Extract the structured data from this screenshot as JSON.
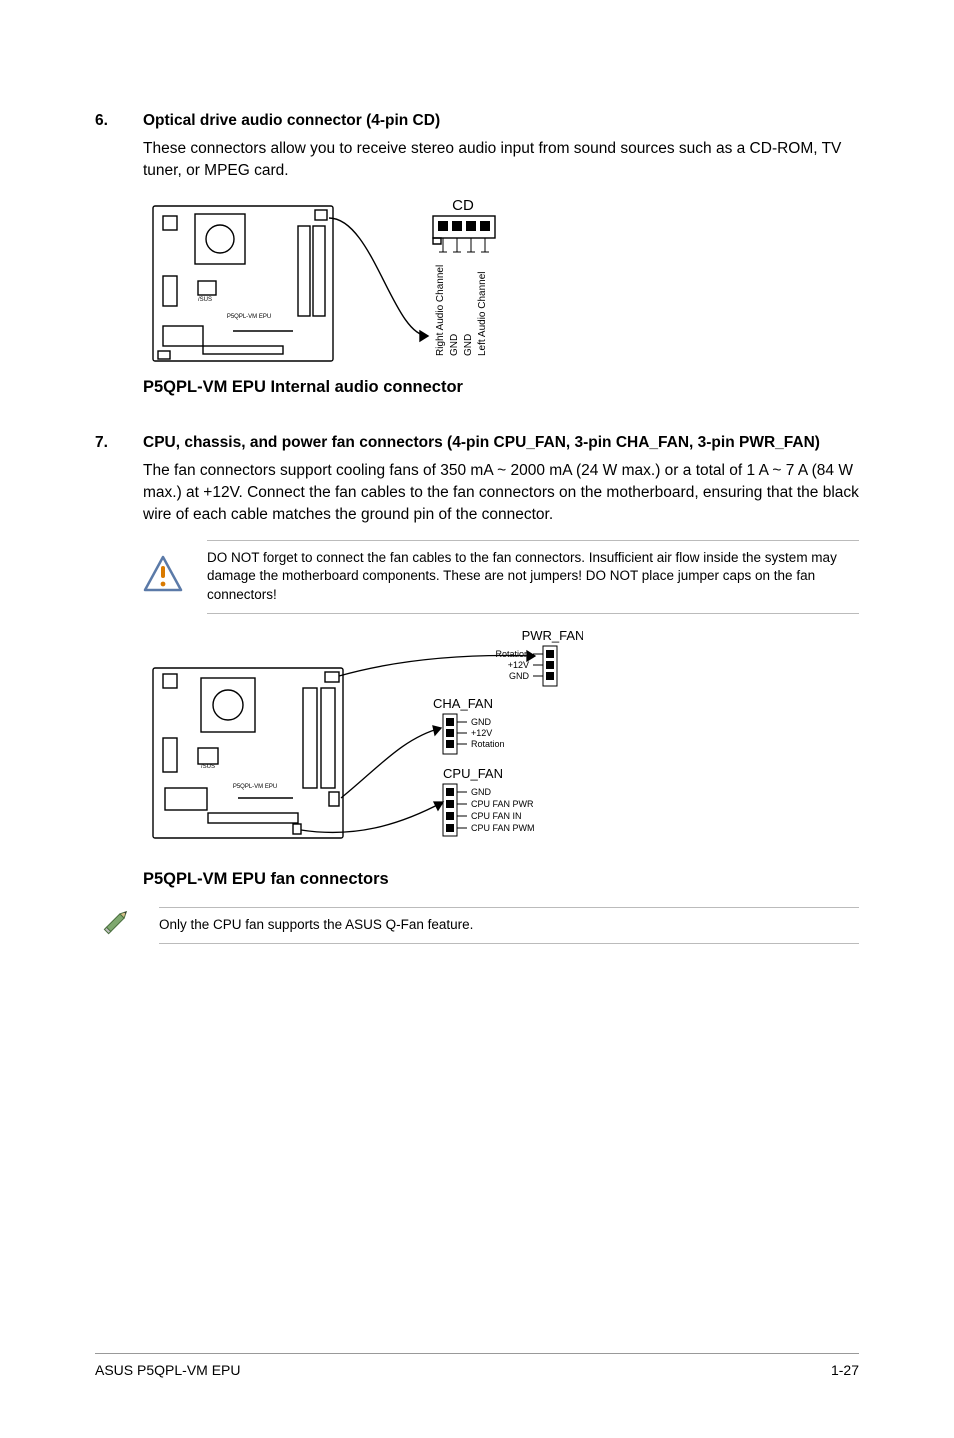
{
  "section6": {
    "num": "6.",
    "title": "Optical drive audio connector (4-pin CD)",
    "body": "These connectors allow you to receive stereo audio input from sound sources such as a CD-ROM, TV tuner, or MPEG card.",
    "fig": {
      "header_label": "CD",
      "pins": {
        "p1": "Right Audio Channel",
        "p2": "GND",
        "p3": "GND",
        "p4": "Left Audio Channel"
      },
      "caption": "P5QPL-VM EPU Internal audio connector"
    }
  },
  "section7": {
    "num": "7.",
    "title": "CPU, chassis, and power fan connectors (4-pin CPU_FAN, 3-pin CHA_FAN, 3-pin PWR_FAN)",
    "body": "The fan connectors support cooling fans of 350 mA ~ 2000 mA (24 W max.) or a total of 1 A ~ 7 A (84 W max.) at +12V. Connect the fan cables to the fan connectors on the motherboard, ensuring that the black wire of each cable matches the ground pin of the connector.",
    "warn": "DO NOT forget to connect the fan cables to the fan connectors. Insufficient air flow inside the system may damage the motherboard components. These are not jumpers! DO NOT place jumper caps on the fan connectors!",
    "fig": {
      "pwr_fan": {
        "label": "PWR_FAN",
        "pins": [
          "Rotation",
          "+12V",
          "GND"
        ]
      },
      "cha_fan": {
        "label": "CHA_FAN",
        "pins": [
          "GND",
          "+12V",
          "Rotation"
        ]
      },
      "cpu_fan": {
        "label": "CPU_FAN",
        "pins": [
          "GND",
          "CPU FAN PWR",
          "CPU FAN IN",
          "CPU FAN PWM"
        ]
      },
      "caption": "P5QPL-VM EPU fan connectors"
    },
    "note": "Only the CPU fan supports the ASUS Q-Fan feature."
  },
  "footer": {
    "left": "ASUS P5QPL-VM EPU",
    "right": "1-27"
  }
}
